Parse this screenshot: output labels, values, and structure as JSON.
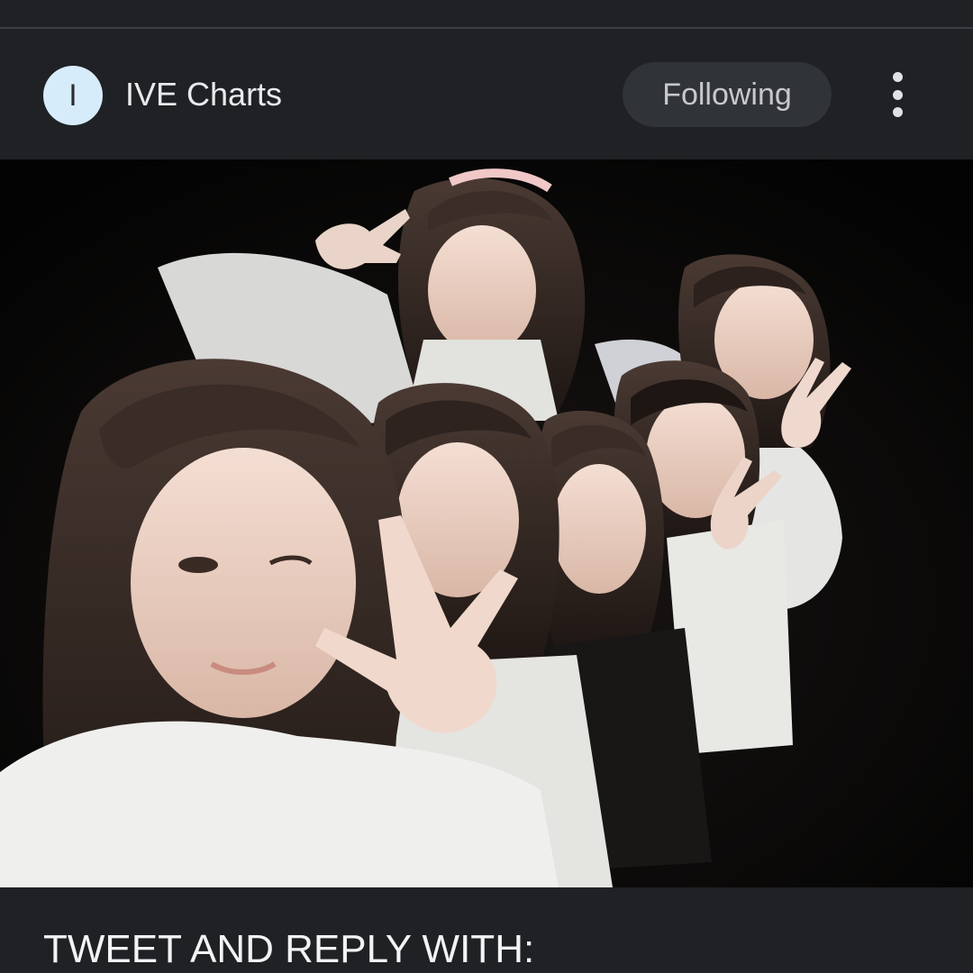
{
  "post": {
    "channel": {
      "avatar_letter": "I",
      "name": "IVE Charts",
      "follow_label": "Following",
      "more_icon": "more-vertical-icon"
    },
    "media": {
      "kind": "photo"
    },
    "text": "TWEET AND REPLY WITH:"
  },
  "colors": {
    "background": "#1f2124",
    "avatar_bg": "#d7ecfb",
    "button_bg": "#303337",
    "text_primary": "#e8eaed"
  }
}
